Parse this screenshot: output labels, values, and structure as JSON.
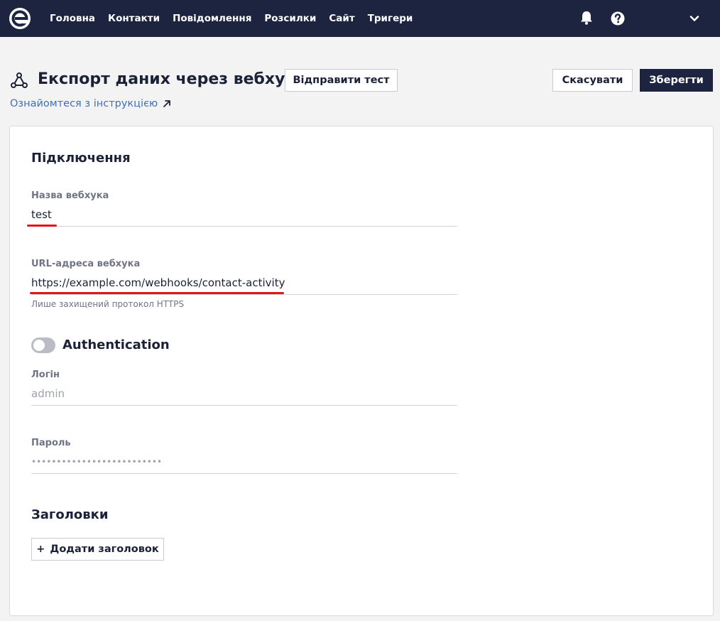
{
  "nav": {
    "items": [
      "Головна",
      "Контакти",
      "Повідомлення",
      "Розсилки",
      "Сайт",
      "Тригери"
    ]
  },
  "header": {
    "title": "Експорт даних через вебхук",
    "send_test": "Відправити тест",
    "cancel": "Скасувати",
    "save": "Зберегти",
    "guide_link": "Ознайомтеся з інструкцією"
  },
  "connection": {
    "section_title": "Підключення",
    "name_label": "Назва вебхука",
    "name_value": "test",
    "url_label": "URL-адреса вебхука",
    "url_value": "https://example.com/webhooks/contact-activity",
    "url_hint": "Лише захищений протокол HTTPS"
  },
  "auth": {
    "title": "Authentication",
    "enabled": false,
    "login_label": "Логін",
    "login_placeholder": "admin",
    "password_label": "Пароль",
    "password_placeholder": "••••••••••••••••••••••••••"
  },
  "headers": {
    "section_title": "Заголовки",
    "add_button": "Додати заголовок"
  },
  "colors": {
    "topbar": "#1d2440",
    "primary_button": "#1d2440",
    "link": "#3d6fc2",
    "annotation_underline": "#e0161b"
  }
}
